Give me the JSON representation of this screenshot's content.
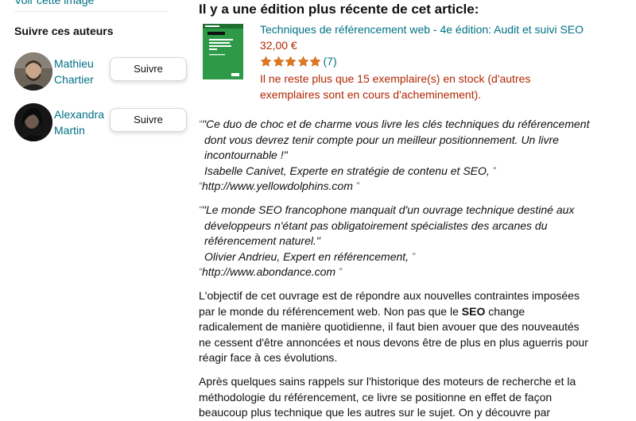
{
  "left": {
    "view_image_link": "Voir cette image",
    "follow_title": "Suivre ces auteurs",
    "authors": [
      {
        "name_line1": "Mathieu",
        "name_line2": "Chartier",
        "follow_label": "Suivre"
      },
      {
        "name_line1": "Alexandra",
        "name_line2": "Martin",
        "follow_label": "Suivre"
      }
    ]
  },
  "newer_edition": {
    "heading": "Il y a une édition plus récente de cet article:",
    "title": "Techniques de référencement web - 4e édition: Audit et suivi SEO",
    "price": "32,00 €",
    "rating_stars": 5,
    "rating_count": "(7)",
    "stock_line1": "Il ne reste plus que 15 exemplaire(s) en stock (d'autres",
    "stock_line2": "exemplaires sont en cours d'acheminement).",
    "cover_color": "#2e9a47"
  },
  "quotes": [
    {
      "line1": "\"Ce duo de choc et de charme vous livre les clés techniques du référencement",
      "line2": "dont vous devrez tenir compte pour un meilleur positionnement. Un livre",
      "line3": "incontournable !\"",
      "line4": "Isabelle Canivet, Experte en stratégie de contenu et SEO,",
      "line5": "http://www.yellowdolphins.com"
    },
    {
      "line1": "\"Le monde SEO francophone manquait d'un ouvrage technique destiné aux",
      "line2": "développeurs n'étant pas obligatoirement spécialistes des arcanes du",
      "line3": "référencement naturel.\"",
      "line4": "Olivier Andrieu, Expert en référencement,",
      "line5": "http://www.abondance.com"
    }
  ],
  "paragraph1": {
    "line1": "L'objectif de cet ouvrage est de répondre aux nouvelles contraintes imposées",
    "line2_before": "par le monde du référencement web. Non pas que le ",
    "line2_bold": "SEO",
    "line2_after": " change",
    "line3": "radicalement de manière quotidienne, il faut bien avouer que des nouveautés",
    "line4": "ne cessent d'être annoncées et nous devons être de plus en plus aguerris pour",
    "line5": "réagir face à ces évolutions."
  },
  "paragraph2": {
    "line1": "Après quelques sains rappels sur l'historique des moteurs de recherche et la",
    "line2": "méthodologie du référencement, ce livre se positionne en effet de façon",
    "line3": "beaucoup plus technique que les autres sur le sujet. On y découvre par"
  },
  "colors": {
    "link": "#007185",
    "price": "#b12704",
    "star": "#de7921"
  }
}
